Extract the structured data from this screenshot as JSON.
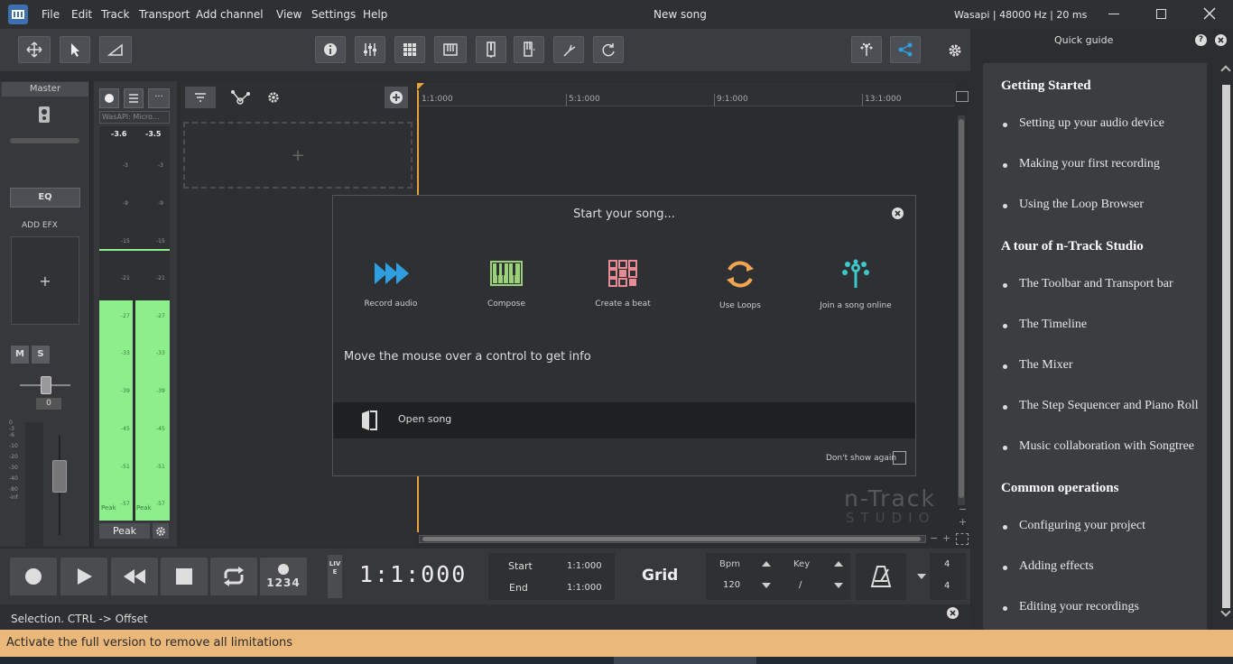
{
  "window": {
    "title": "New song",
    "audio_info": "Wasapi | 48000 Hz | 20 ms",
    "menu": [
      "File",
      "Edit",
      "Track",
      "Transport",
      "Add channel",
      "View",
      "Settings",
      "Help"
    ]
  },
  "master": {
    "label": "Master",
    "eq_label": "EQ",
    "add_efx_label": "ADD EFX",
    "add_symbol": "+",
    "mute_label": "M",
    "solo_label": "S",
    "pan_value": "0",
    "fader_scale": [
      "0",
      "-3",
      "-6",
      "-10",
      "-20",
      "-30",
      "-40",
      "-80",
      "-inf"
    ]
  },
  "meter": {
    "device_label": "WasAPI: Micro...",
    "peak_left": "-3.6",
    "peak_right": "-3.5",
    "scale": [
      "-3",
      "-9",
      "-15",
      "-21",
      "-27",
      "-33",
      "-39",
      "-45",
      "-51",
      "-57"
    ],
    "peak_label": "Peak",
    "peak_button": "Peak"
  },
  "tracks": {
    "add_track_symbol": "+"
  },
  "ruler": {
    "marks": [
      "1:1:000",
      "5:1:000",
      "9:1:000",
      "13:1:000"
    ]
  },
  "dialog": {
    "title": "Start your song...",
    "options": [
      {
        "label": "Record audio",
        "icon": "record-audio-icon",
        "color": "#2f9fe0"
      },
      {
        "label": "Compose",
        "icon": "piano-icon",
        "color": "#9bd07a"
      },
      {
        "label": "Create a beat",
        "icon": "beat-pads-icon",
        "color": "#e78b95"
      },
      {
        "label": "Use Loops",
        "icon": "loops-icon",
        "color": "#f0a550"
      },
      {
        "label": "Join a song online",
        "icon": "songtree-icon",
        "color": "#3ec9c9"
      }
    ],
    "hint": "Move the mouse over a control to get info",
    "open_song_label": "Open song",
    "dont_show_label": "Don't show again"
  },
  "transport": {
    "live_label": "LIVE",
    "position": "1:1:000",
    "start_label": "Start",
    "start_value": "1:1:000",
    "end_label": "End",
    "end_value": "1:1:000",
    "grid_label": "Grid",
    "bpm_label": "Bpm",
    "bpm_value": "120",
    "key_label": "Key",
    "key_value": "/",
    "count_in": "1234",
    "time_sig_top": "4",
    "time_sig_bottom": "4"
  },
  "status": {
    "text": "Selection. CTRL -> Offset"
  },
  "guide": {
    "title": "Quick guide",
    "sections": [
      {
        "title": "Getting Started",
        "items": [
          "Setting up your audio device",
          "Making your first recording",
          "Using the Loop Browser"
        ]
      },
      {
        "title": "A tour of n-Track Studio",
        "items": [
          "The Toolbar and Transport bar",
          "The Timeline",
          "The Mixer",
          "The Step Sequencer and Piano Roll",
          "Music collaboration with Songtree"
        ]
      },
      {
        "title": "Common operations",
        "items": [
          "Configuring your project",
          "Adding effects",
          "Editing your recordings"
        ]
      }
    ]
  },
  "watermark": {
    "line1": "n-Track",
    "line2": "STUDIO"
  },
  "banner": {
    "text": "Activate the full version to remove all limitations"
  },
  "colors": {
    "accent": "#2f9fe0",
    "meter_green": "#8cef8c",
    "banner": "#e9b87a",
    "playhead": "#e8a33d"
  }
}
